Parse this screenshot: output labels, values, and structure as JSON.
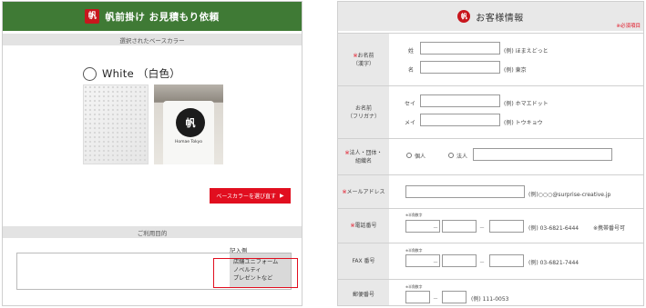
{
  "left": {
    "header_logo": "帆",
    "header_title": "帆前掛け お見積もり依頼",
    "base_color_section": "選択されたベースカラー",
    "selected_color": "White （白色）",
    "apron_logo": "帆",
    "apron_brand": "Homae Tokyo",
    "select_button_label": "ベースカラーを選び直す",
    "select_button_arrow": "▶",
    "purpose_section": "ご利用目的",
    "example_label": "記入例",
    "example_lines": [
      "店舗ユニフォーム",
      "ノベルティ",
      "プレゼントなど"
    ]
  },
  "right": {
    "header_logo": "帆",
    "header_title": "お客様情報",
    "required_note": "※必須項目",
    "name_kanji": {
      "label_line1": "お名前",
      "label_line2": "（漢字）",
      "sei": "姓",
      "mei": "名",
      "sei_example": "(例) ほまえどっと",
      "mei_example": "(例) 東京"
    },
    "name_kana": {
      "label_line1": "お名前",
      "label_line2": "（フリガナ）",
      "sei": "セイ",
      "mei": "メイ",
      "sei_example": "(例) ホマエドット",
      "mei_example": "(例) トウキョウ"
    },
    "corp": {
      "label_line1": "法人・団体・",
      "label_line2": "組織名",
      "option_individual": "個人",
      "option_corporate": "法人"
    },
    "email": {
      "label": "メールアドレス",
      "example": "(例)○○○@surprise-creative.jp"
    },
    "phone": {
      "label": "電話番号",
      "half_width_note": "※半角数字",
      "example": "(例) 03-6821-6444",
      "mobile_note": "※携帯番号可"
    },
    "fax": {
      "label": "FAX 番号",
      "half_width_note": "※半角数字",
      "example": "(例) 03-6821-7444"
    },
    "postal": {
      "label": "郵便番号",
      "half_width_note": "※半角数字",
      "example": "(例) 111-0053"
    },
    "dash": "－",
    "required_mark": "※"
  }
}
